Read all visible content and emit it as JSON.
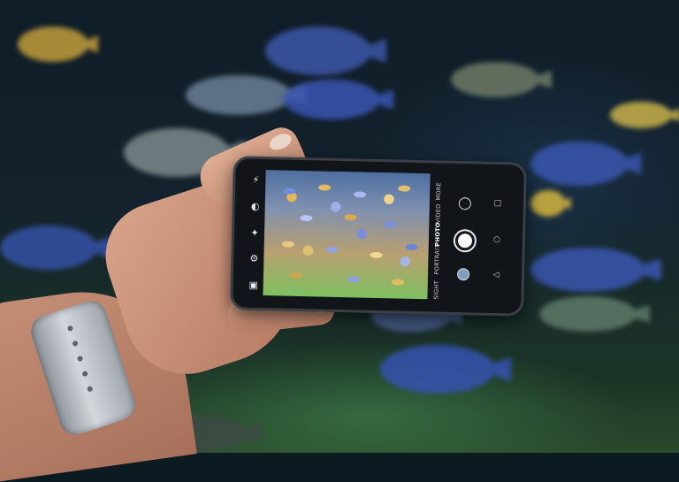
{
  "camera_app": {
    "modes": [
      "SIGHT",
      "PORTRAIT",
      "PHOTO",
      "VIDEO",
      "MORE"
    ],
    "active_mode": "PHOTO",
    "left_icons": [
      "flash-off-icon",
      "effects-icon",
      "filter-icon",
      "settings-icon",
      "frame-icon"
    ],
    "right_icons": [
      "ai-lens-icon",
      "shutter-button",
      "gallery-thumbnail"
    ],
    "nav_icons": [
      "back-icon",
      "home-icon",
      "recents-icon"
    ]
  }
}
